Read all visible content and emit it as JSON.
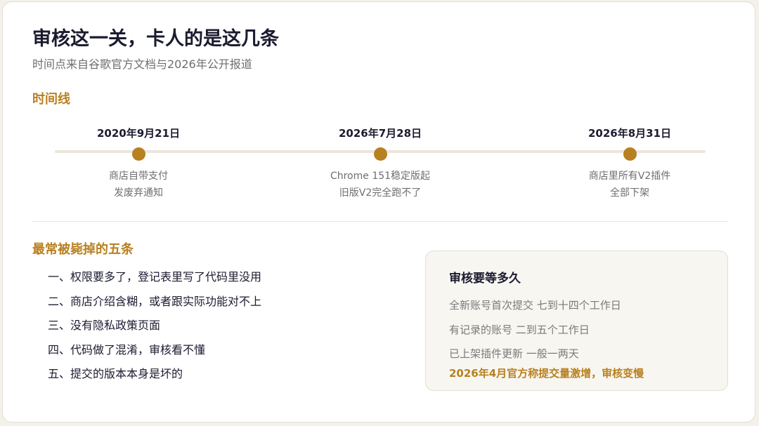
{
  "header": {
    "title": "审核这一关，卡人的是这几条",
    "subtitle": "时间点来自谷歌官方文档与2026年公开报道"
  },
  "timeline": {
    "heading": "时间线",
    "events": [
      {
        "date": "2020年9月21日",
        "desc_line1": "商店自带支付",
        "desc_line2": "发废弃通知"
      },
      {
        "date": "2026年7月28日",
        "desc_line1": "Chrome 151稳定版起",
        "desc_line2": "旧版V2完全跑不了"
      },
      {
        "date": "2026年8月31日",
        "desc_line1": "商店里所有V2插件",
        "desc_line2": "全部下架"
      }
    ]
  },
  "reasons": {
    "heading": "最常被毙掉的五条",
    "items": [
      "一、权限要多了，登记表里写了代码里没用",
      "二、商店介绍含糊，或者跟实际功能对不上",
      "三、没有隐私政策页面",
      "四、代码做了混淆，审核看不懂",
      "五、提交的版本本身是坏的"
    ]
  },
  "review_time": {
    "title": "审核要等多久",
    "rows": [
      "全新账号首次提交 七到十四个工作日",
      "有记录的账号 二到五个工作日",
      "已上架插件更新 一般一两天"
    ],
    "note": "2026年4月官方称提交量激增，审核变慢"
  },
  "colors": {
    "accent": "#b8801f",
    "heading": "#1b1b30",
    "muted": "#6e6e6e",
    "card_bg": "#f8f6f1"
  }
}
